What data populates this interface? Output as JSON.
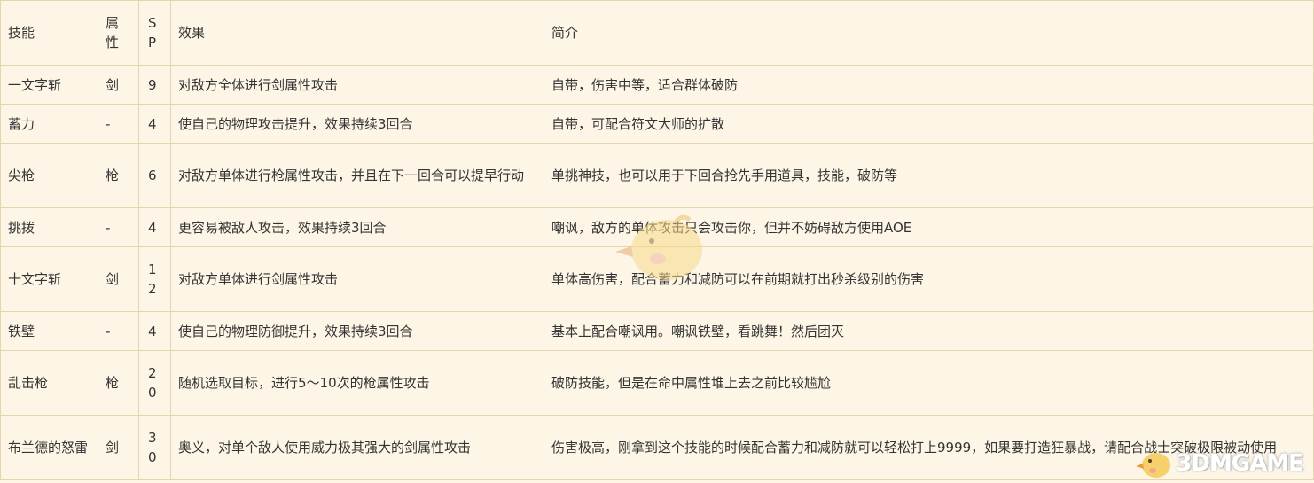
{
  "header": {
    "skill": "技能",
    "attr": "属\n性",
    "sp": "S\nP",
    "effect": "效果",
    "intro": "简介"
  },
  "rows": [
    {
      "skill": "一文字斩",
      "attr": "剑",
      "sp": "9",
      "effect": "对敌方全体进行剑属性攻击",
      "intro": "自带，伤害中等，适合群体破防"
    },
    {
      "skill": "蓄力",
      "attr": "-",
      "sp": "4",
      "effect": "使自己的物理攻击提升，效果持续3回合",
      "intro": "自带，可配合符文大师的扩散"
    },
    {
      "skill": "尖枪",
      "attr": "枪",
      "sp": "6",
      "effect": "对敌方单体进行枪属性攻击，并且在下一回合可以提早行动",
      "intro": "单挑神技，也可以用于下回合抢先手用道具，技能，破防等"
    },
    {
      "skill": "挑拨",
      "attr": "-",
      "sp": "4",
      "effect": "更容易被敌人攻击，效果持续3回合",
      "intro": "嘲讽，敌方的单体攻击只会攻击你，但并不妨碍敌方使用AOE"
    },
    {
      "skill": "十文字斩",
      "attr": "剑",
      "sp": "1\n2",
      "effect": "对敌方单体进行剑属性攻击",
      "intro": "单体高伤害，配合蓄力和减防可以在前期就打出秒杀级别的伤害"
    },
    {
      "skill": "铁壁",
      "attr": "-",
      "sp": "4",
      "effect": "使自己的物理防御提升，效果持续3回合",
      "intro": "基本上配合嘲讽用。嘲讽铁壁，看跳舞！然后团灭"
    },
    {
      "skill": "乱击枪",
      "attr": "枪",
      "sp": "2\n0",
      "effect": "随机选取目标，进行5～10次的枪属性攻击",
      "intro": "破防技能，但是在命中属性堆上去之前比较尴尬"
    },
    {
      "skill": "布兰德的怒雷",
      "attr": "剑",
      "sp": "3\n0",
      "effect": "奥义，对单个敌人使用威力极其强大的剑属性攻击",
      "intro": "伤害极高，刚拿到这个技能的时候配合蓄力和减防就可以轻松打上9999，如果要打造狂暴战，请配合战士突破极限被动使用"
    }
  ],
  "watermark": {
    "logo_text": "3DMGAME"
  }
}
